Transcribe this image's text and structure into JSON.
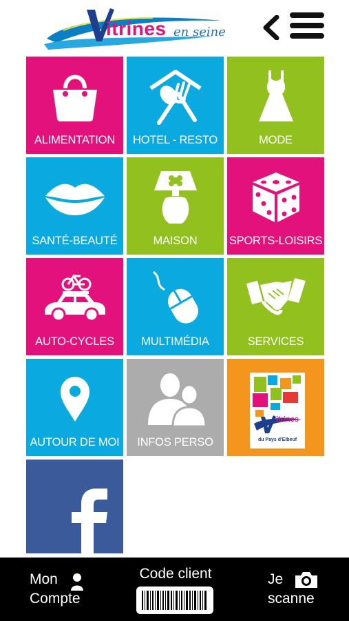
{
  "header": {
    "brand_main": "itrines",
    "brand_initial": "V",
    "brand_sub": "en seine",
    "back_icon": "chevron-left-icon",
    "menu_icon": "hamburger-menu-icon"
  },
  "tiles": [
    {
      "label": "ALIMENTATION",
      "icon": "shopping-bag-icon",
      "color": "#e2117b"
    },
    {
      "label": "HOTEL - RESTO",
      "icon": "house-fork-spoon-icon",
      "color": "#0aa9e0"
    },
    {
      "label": "MODE",
      "icon": "dress-icon",
      "color": "#92c01f"
    },
    {
      "label": "SANTÉ-BEAUTÉ",
      "icon": "lips-icon",
      "color": "#0aa9e0"
    },
    {
      "label": "MAISON",
      "icon": "lamp-icon",
      "color": "#92c01f"
    },
    {
      "label": "SPORTS-LOISIRS",
      "icon": "dice-icon",
      "color": "#e2117b"
    },
    {
      "label": "AUTO-CYCLES",
      "icon": "car-bike-icon",
      "color": "#e2117b"
    },
    {
      "label": "MULTIMÉDIA",
      "icon": "mouse-icon",
      "color": "#0aa9e0"
    },
    {
      "label": "SERVICES",
      "icon": "handshake-icon",
      "color": "#92c01f"
    },
    {
      "label": "AUTOUR DE MOI",
      "icon": "map-pin-icon",
      "color": "#0aa9e0"
    },
    {
      "label": "INFOS PERSO",
      "icon": "users-icon",
      "color": "#acacac"
    },
    {
      "label": "",
      "icon": "vitrines-elbeuf-logo",
      "color": "#f4961e",
      "logo_text": "du Pays d'Elbeuf",
      "logo_initial": "V",
      "logo_word": "itrines"
    },
    {
      "label": "",
      "icon": "facebook-icon",
      "color": "#3b5a9a"
    }
  ],
  "bottom_bar": {
    "account_line1": "Mon",
    "account_line2": "Compte",
    "account_icon": "user-icon",
    "client_label": "Code client",
    "client_icon": "barcode-icon",
    "scan_line1": "Je",
    "scan_line2": "scanne",
    "scan_icon": "camera-icon"
  }
}
